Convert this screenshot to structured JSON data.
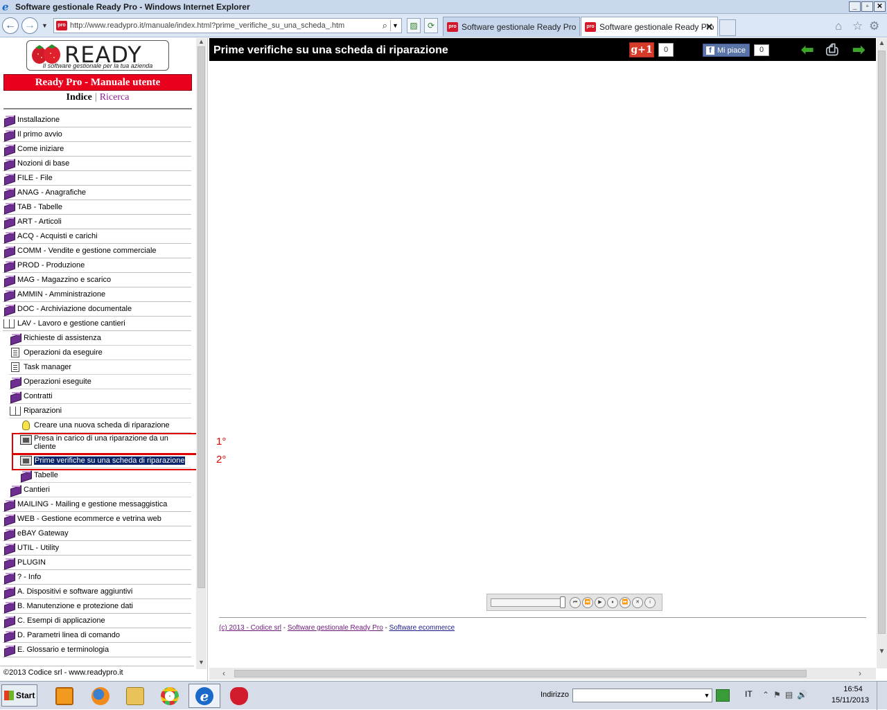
{
  "window": {
    "title": "Software gestionale Ready Pro - Windows Internet Explorer",
    "buttons": {
      "minimize": "_",
      "maximize": "▫",
      "close": "✕"
    }
  },
  "browser": {
    "address": "http://www.readypro.it/manuale/index.html?prime_verifiche_su_una_scheda_.htm",
    "favicon_text": "pro",
    "tabs": [
      {
        "label": "Software gestionale Ready Pro",
        "active": false
      },
      {
        "label": "Software gestionale Ready Pro",
        "active": true,
        "close": "✕"
      }
    ],
    "icons": [
      "back-icon",
      "forward-icon",
      "search-icon",
      "compatibility-icon",
      "refresh-icon",
      "home-icon",
      "favorites-star-icon",
      "tools-gear-icon"
    ]
  },
  "sidebar": {
    "logo_word": "READY",
    "logo_tagline": "Il software gestionale per la tua azienda",
    "manual_title": "Ready Pro - Manuale utente",
    "index_label": "Indice",
    "separator": "|",
    "search_label": "Ricerca",
    "copyright": "©2013 Codice srl - www.readypro.it",
    "items": [
      {
        "label": "Installazione",
        "icon": "book"
      },
      {
        "label": "Il primo avvio",
        "icon": "book"
      },
      {
        "label": "Come iniziare",
        "icon": "book"
      },
      {
        "label": "Nozioni di base",
        "icon": "book"
      },
      {
        "label": "FILE - File",
        "icon": "book"
      },
      {
        "label": "ANAG - Anagrafiche",
        "icon": "book"
      },
      {
        "label": "TAB - Tabelle",
        "icon": "book"
      },
      {
        "label": "ART - Articoli",
        "icon": "book"
      },
      {
        "label": "ACQ -  Acquisti e carichi",
        "icon": "book"
      },
      {
        "label": "COMM - Vendite e gestione commerciale",
        "icon": "book"
      },
      {
        "label": "PROD - Produzione",
        "icon": "book"
      },
      {
        "label": "MAG - Magazzino e scarico",
        "icon": "book"
      },
      {
        "label": "AMMIN - Amministrazione",
        "icon": "book"
      },
      {
        "label": "DOC - Archiviazione documentale",
        "icon": "book"
      },
      {
        "label": "LAV - Lavoro e gestione cantieri",
        "icon": "open-book"
      },
      {
        "label": "Richieste di assistenza",
        "icon": "book"
      },
      {
        "label": "Operazioni da eseguire",
        "icon": "page"
      },
      {
        "label": "Task manager",
        "icon": "page"
      },
      {
        "label": "Operazioni eseguite",
        "icon": "book"
      },
      {
        "label": "Contratti",
        "icon": "book"
      },
      {
        "label": "Riparazioni",
        "icon": "open-book"
      },
      {
        "label": "Creare una nuova scheda di riparazione",
        "icon": "bulb"
      },
      {
        "label": "Presa in carico di una riparazione da un cliente",
        "icon": "film"
      },
      {
        "label": "Prime verifiche su una scheda di riparazione",
        "icon": "film",
        "selected": true
      },
      {
        "label": "Tabelle",
        "icon": "book"
      },
      {
        "label": "Cantieri",
        "icon": "book"
      },
      {
        "label": "MAILING - Mailing e gestione messaggistica",
        "icon": "book"
      },
      {
        "label": "WEB - Gestione ecommerce e vetrina web",
        "icon": "book"
      },
      {
        "label": "eBAY Gateway",
        "icon": "book"
      },
      {
        "label": "UTIL - Utility",
        "icon": "book"
      },
      {
        "label": "PLUGIN",
        "icon": "book"
      },
      {
        "label": "? - Info",
        "icon": "book"
      },
      {
        "label": "A. Dispositivi e software aggiuntivi",
        "icon": "book"
      },
      {
        "label": "B. Manutenzione e protezione dati",
        "icon": "book"
      },
      {
        "label": "C. Esempi di applicazione",
        "icon": "book"
      },
      {
        "label": "D. Parametri linea di comando",
        "icon": "book"
      },
      {
        "label": "E. Glossario e terminologia",
        "icon": "book"
      }
    ]
  },
  "main": {
    "title": "Prime verifiche su una scheda di riparazione",
    "gplus_label": "g+1",
    "gplus_count": "0",
    "fb_label": "Mi piace",
    "fb_count": "0",
    "annotations": [
      "1°",
      "2°"
    ],
    "footer": {
      "copyright_link": "(c) 2013 - Codice srl",
      "sep": " - ",
      "link2": "Software gestionale Ready Pro",
      "link3": "Software ecommerce"
    },
    "player_buttons": [
      "⏮",
      "⏪",
      "▶",
      "⏸",
      "⏩",
      "✕",
      "i"
    ]
  },
  "taskbar": {
    "start_label": "Start",
    "indirizzo_label": "Indirizzo",
    "lang": "IT",
    "time": "16:54",
    "date": "15/11/2013",
    "apps": [
      "media-player",
      "firefox",
      "file-explorer",
      "chrome",
      "internet-explorer",
      "ready-pro"
    ]
  }
}
